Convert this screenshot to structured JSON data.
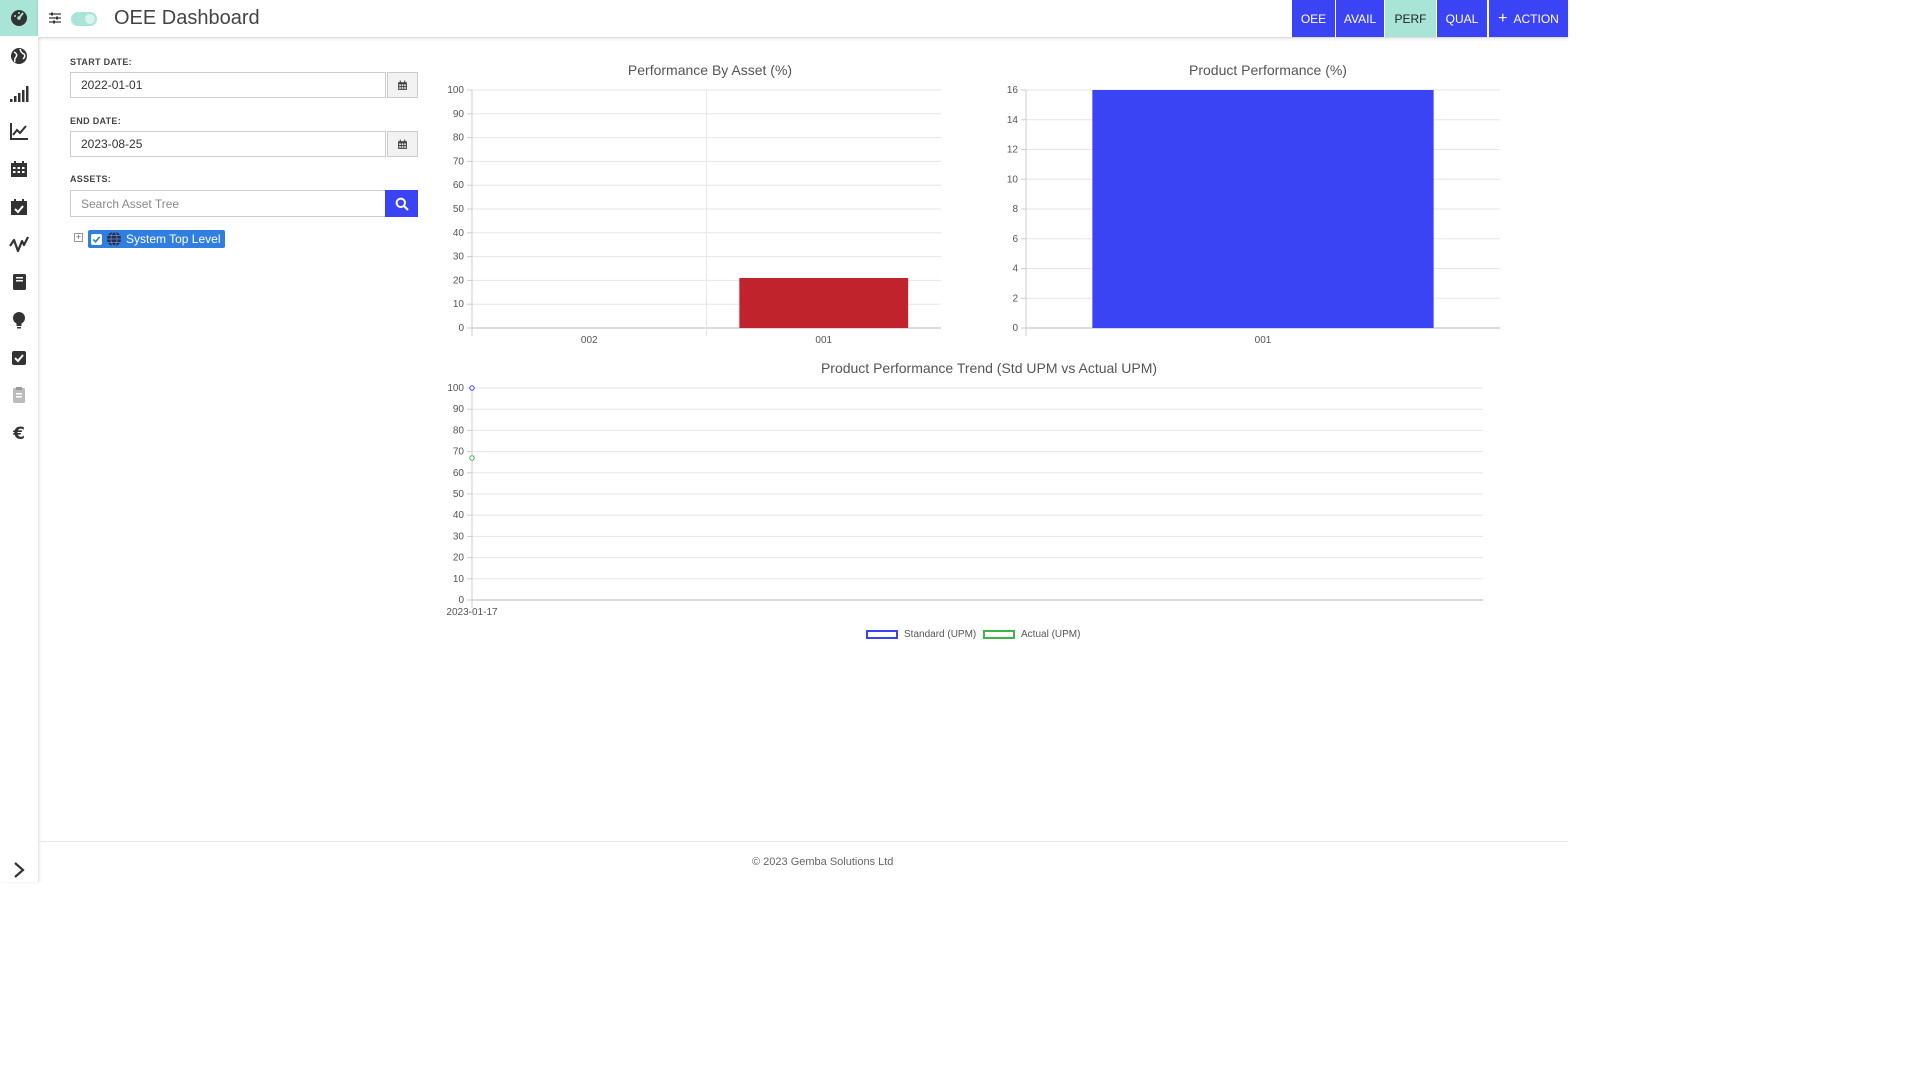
{
  "header": {
    "title": "OEE Dashboard",
    "tabs": [
      {
        "label": "OEE"
      },
      {
        "label": "AVAIL"
      },
      {
        "label": "PERF"
      },
      {
        "label": "QUAL"
      }
    ],
    "action_label": "ACTION",
    "accent_color": "#3a44f5",
    "active_color": "#a8e5d6"
  },
  "sidebar": {
    "items": [
      {
        "icon": "dashboard-gauge-icon"
      },
      {
        "icon": "globe-icon"
      },
      {
        "icon": "signal-bars-icon"
      },
      {
        "icon": "line-chart-icon"
      },
      {
        "icon": "calendar-icon"
      },
      {
        "icon": "calendar-check-icon"
      },
      {
        "icon": "waveform-icon"
      },
      {
        "icon": "book-icon"
      },
      {
        "icon": "lightbulb-icon"
      },
      {
        "icon": "checkbox-icon"
      },
      {
        "icon": "clipboard-icon"
      },
      {
        "icon": "euro-icon"
      }
    ],
    "expand_icon": "chevron-right-icon"
  },
  "filters": {
    "start_label": "START DATE:",
    "start_value": "2022-01-01",
    "end_label": "END DATE:",
    "end_value": "2023-08-25",
    "assets_label": "ASSETS:",
    "search_placeholder": "Search Asset Tree",
    "tree_root_label": "System Top Level"
  },
  "chart_data": [
    {
      "type": "bar",
      "title": "Performance By Asset (%)",
      "categories": [
        "002",
        "001"
      ],
      "values": [
        0,
        21
      ],
      "ylim": [
        0,
        100
      ],
      "yticks": [
        0,
        10,
        20,
        30,
        40,
        50,
        60,
        70,
        80,
        90,
        100
      ],
      "color": "#c0232c",
      "grid": true
    },
    {
      "type": "bar",
      "title": "Product Performance (%)",
      "categories": [
        "001"
      ],
      "values": [
        16
      ],
      "ylim": [
        0,
        16
      ],
      "yticks": [
        0,
        2,
        4,
        6,
        8,
        10,
        12,
        14,
        16
      ],
      "color": "#3a44f5",
      "grid": true
    },
    {
      "type": "line",
      "title": "Product Performance Trend (Std UPM vs Actual UPM)",
      "x": [
        "2023-01-17"
      ],
      "ylim": [
        0,
        100
      ],
      "yticks": [
        0,
        10,
        20,
        30,
        40,
        50,
        60,
        70,
        80,
        90,
        100
      ],
      "series": [
        {
          "name": "Standard (UPM)",
          "values": [
            100
          ],
          "color": "#3a44f5"
        },
        {
          "name": "Actual (UPM)",
          "values": [
            67
          ],
          "color": "#3cb54a"
        }
      ],
      "legend": "bottom",
      "grid": true
    }
  ],
  "footer": {
    "text": "© 2023 Gemba Solutions Ltd"
  }
}
